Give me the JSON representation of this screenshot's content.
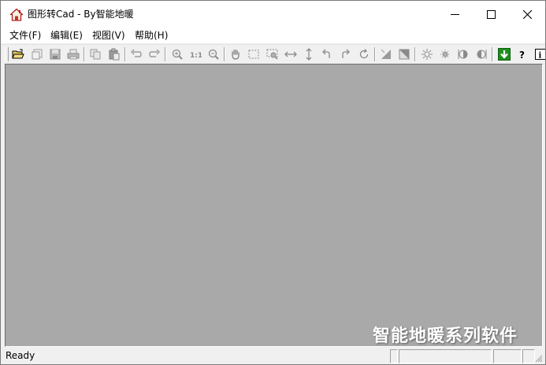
{
  "window": {
    "title": "图形转Cad - By智能地暖",
    "icon": "house-icon"
  },
  "window_controls": [
    "minimize-icon",
    "maximize-icon",
    "close-icon"
  ],
  "menu": {
    "items": [
      {
        "label": "文件(F)"
      },
      {
        "label": "编辑(E)"
      },
      {
        "label": "视图(V)"
      },
      {
        "label": "帮助(H)"
      }
    ]
  },
  "toolbar": {
    "buttons": [
      {
        "icon": "open-folder-icon",
        "enabled": true
      },
      {
        "icon": "new-layer-icon",
        "enabled": false
      },
      {
        "icon": "save-icon",
        "enabled": false
      },
      {
        "icon": "print-icon",
        "enabled": false
      },
      {
        "icon": "copy-icon",
        "enabled": false
      },
      {
        "icon": "paste-icon",
        "enabled": false
      },
      {
        "icon": "undo-icon",
        "enabled": false
      },
      {
        "icon": "redo-icon",
        "enabled": false
      },
      {
        "icon": "zoom-in-icon",
        "enabled": false
      },
      {
        "icon": "zoom-actual-icon",
        "enabled": false,
        "text": "1:1"
      },
      {
        "icon": "zoom-out-icon",
        "enabled": false
      },
      {
        "icon": "pan-hand-icon",
        "enabled": false
      },
      {
        "icon": "select-rect-icon",
        "enabled": false
      },
      {
        "icon": "zoom-window-icon",
        "enabled": false
      },
      {
        "icon": "fit-width-icon",
        "enabled": false
      },
      {
        "icon": "fit-height-icon",
        "enabled": false
      },
      {
        "icon": "rotate-left-icon",
        "enabled": false
      },
      {
        "icon": "rotate-right-icon",
        "enabled": false
      },
      {
        "icon": "rotate-reset-icon",
        "enabled": false
      },
      {
        "icon": "diagonal-fill-icon",
        "enabled": false
      },
      {
        "icon": "diagonal-invert-icon",
        "enabled": false
      },
      {
        "icon": "brightness-up-icon",
        "enabled": false
      },
      {
        "icon": "brightness-down-icon",
        "enabled": false
      },
      {
        "icon": "contrast-up-icon",
        "enabled": false
      },
      {
        "icon": "contrast-down-icon",
        "enabled": false
      },
      {
        "icon": "download-arrow-icon",
        "enabled": true
      },
      {
        "icon": "help-question-icon",
        "enabled": true,
        "text": "?"
      },
      {
        "icon": "info-icon",
        "enabled": true
      }
    ],
    "accent_green": "#1e8e1e"
  },
  "canvas": {
    "background": "#a9a9a9",
    "watermark": "智能地暖系列软件"
  },
  "statusbar": {
    "text": "Ready"
  }
}
